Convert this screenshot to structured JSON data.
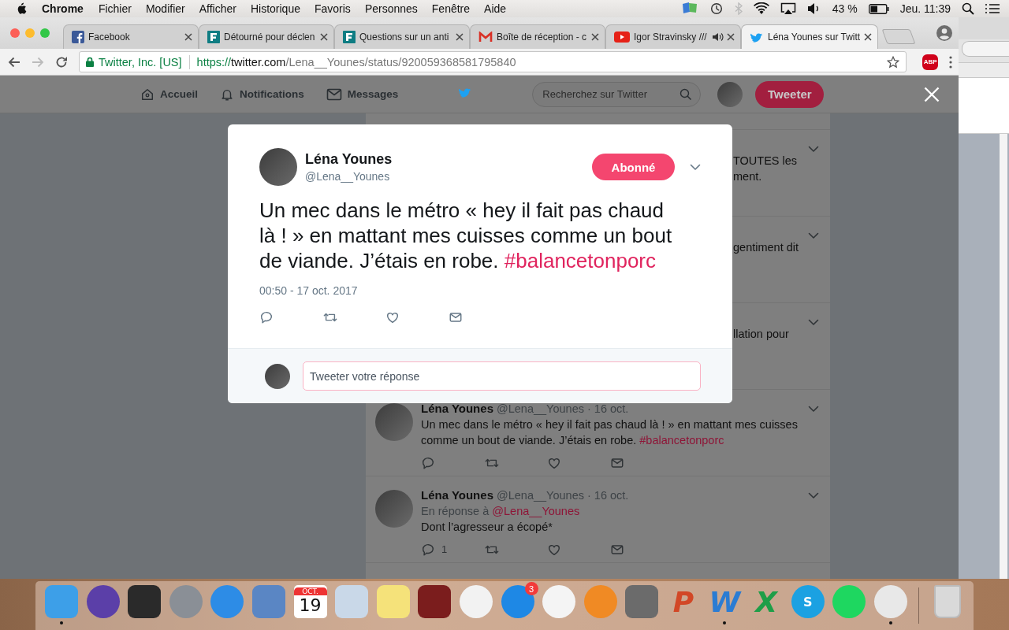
{
  "menu_bar": {
    "app": "Chrome",
    "items": [
      "Fichier",
      "Modifier",
      "Afficher",
      "Historique",
      "Favoris",
      "Personnes",
      "Fenêtre",
      "Aide"
    ],
    "battery": "43 %",
    "clock": "Jeu. 11:39"
  },
  "browser": {
    "tabs": [
      {
        "label": "Facebook",
        "kind": "facebook",
        "selected": false,
        "audio": false
      },
      {
        "label": "Détourné pour déclen",
        "kind": "figaro",
        "selected": false,
        "audio": false
      },
      {
        "label": "Questions sur un anti",
        "kind": "figaro",
        "selected": false,
        "audio": false
      },
      {
        "label": "Boîte de réception - c",
        "kind": "gmail",
        "selected": false,
        "audio": false
      },
      {
        "label": "Igor Stravinsky ///",
        "kind": "youtube",
        "selected": false,
        "audio": true
      },
      {
        "label": "Léna Younes sur Twitt",
        "kind": "twitter",
        "selected": true,
        "audio": false
      }
    ],
    "site_identity": "Twitter, Inc. [US]",
    "url": {
      "scheme": "https://",
      "host": "twitter.com",
      "path": "/Lena__Younes/status/920059368581795840"
    },
    "extension_badge": "ABP"
  },
  "twitter_nav": {
    "items": [
      {
        "label": "Accueil",
        "kind": "home"
      },
      {
        "label": "Notifications",
        "kind": "bell"
      },
      {
        "label": "Messages",
        "kind": "envelope"
      }
    ],
    "search": {
      "placeholder": "Recherchez sur Twitter"
    },
    "tweet_button": "Tweeter"
  },
  "timeline": [
    {
      "kind": "fragment",
      "lines": [
        "TOUTES les",
        "ment."
      ]
    },
    {
      "kind": "fragment",
      "lines": [
        "gentiment dit"
      ]
    },
    {
      "kind": "fragment",
      "lines": [
        "llation pour"
      ]
    },
    {
      "kind": "tweet",
      "name": "Léna Younes",
      "handle": "@Lena__Younes",
      "date": "· 16 oct.",
      "text": "Un mec dans le métro « hey il fait pas chaud là ! » en mattant mes cuisses comme un bout de viande. J’étais en robe.",
      "hashtag": "#balancetonporc"
    },
    {
      "kind": "tweet",
      "name": "Léna Younes",
      "handle": "@Lena__Younes",
      "date": "· 16 oct.",
      "reply_to_label": "En réponse à",
      "reply_to": "@Lena__Younes",
      "text": "Dont l’agresseur a écopé*",
      "reply_count": "1"
    }
  ],
  "modal": {
    "name": "Léna Younes",
    "handle": "@Lena__Younes",
    "follow_button": "Abonné",
    "text": "Un mec dans le métro « hey il fait pas chaud là ! » en mattant mes cuisses comme un bout de viande. J’étais en robe.",
    "hashtag": "#balancetonporc",
    "timestamp": "00:50 - 17 oct. 2017",
    "reply": {
      "placeholder": "Tweeter votre réponse"
    }
  },
  "dock": [
    {
      "kind": "tile",
      "color": "#3d9fe8",
      "running": true
    },
    {
      "kind": "circle",
      "color": "#5b3fa8",
      "running": false
    },
    {
      "kind": "tile",
      "color": "#2a2a2a",
      "running": false
    },
    {
      "kind": "circle",
      "color": "#8a8f96",
      "running": false
    },
    {
      "kind": "circle",
      "color": "#2d8ce6",
      "running": false
    },
    {
      "kind": "tile",
      "color": "#5a86c4",
      "running": false
    },
    {
      "kind": "calendar",
      "color": "#ffffff",
      "month": "OCT.",
      "day": "19",
      "running": false
    },
    {
      "kind": "tile",
      "color": "#c9d8e8",
      "running": false
    },
    {
      "kind": "tile",
      "color": "#f5e27a",
      "running": false
    },
    {
      "kind": "tile",
      "color": "#7b1d1d",
      "running": false
    },
    {
      "kind": "circle",
      "color": "#f2f2f2",
      "running": false
    },
    {
      "kind": "circle",
      "color": "#1e88e5",
      "badge": "3",
      "running": false
    },
    {
      "kind": "circle",
      "color": "#f4f4f4",
      "running": false
    },
    {
      "kind": "circle",
      "color": "#f08a24",
      "running": false
    },
    {
      "kind": "tile",
      "color": "#6b6b6b",
      "running": false
    },
    {
      "kind": "letter",
      "color": "#d24726",
      "glyph": "P",
      "running": false
    },
    {
      "kind": "letter",
      "color": "#2b7cd3",
      "glyph": "W",
      "running": true
    },
    {
      "kind": "letter",
      "color": "#1e9e48",
      "glyph": "X",
      "running": false
    },
    {
      "kind": "circle",
      "color": "#1ba1e2",
      "glyph": "S",
      "running": false
    },
    {
      "kind": "circle",
      "color": "#1ed760",
      "running": false
    },
    {
      "kind": "circle",
      "color": "#e8e8e8",
      "running": true
    },
    {
      "kind": "trash",
      "color": "#d9d9d9",
      "running": false
    }
  ]
}
